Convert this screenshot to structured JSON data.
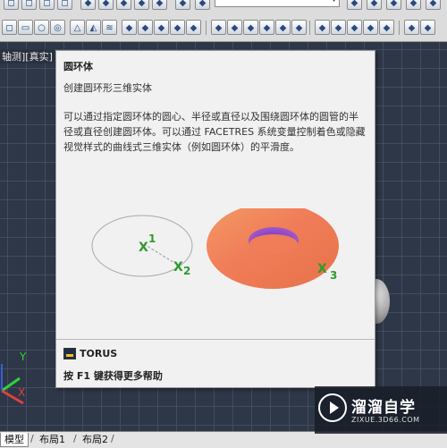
{
  "viewport": {
    "label": "轴测][真实]"
  },
  "tooltip": {
    "title": "圆环体",
    "subtitle": "创建圆环形三维实体",
    "description": "可以通过指定圆环体的圆心、半径或直径以及围绕圆环体的圆管的半径或直径创建圆环体。可以通过 FACETRES 系统变量控制着色或隐藏视觉样式的曲线式三维实体（例如圆环体）的平滑度。",
    "illustration": {
      "point_1_mark": "X",
      "point_1_label": "1",
      "point_2_mark": "X",
      "point_2_label": "2",
      "point_3_mark": "X",
      "point_3_label": "3"
    },
    "command": "TORUS",
    "help": "按 F1 键获得更多帮助"
  },
  "ucs": {
    "y_label": "Y",
    "x_label": "X"
  },
  "layout_tabs": [
    {
      "label": "模型",
      "active": true
    },
    {
      "label": "布局1",
      "active": false
    },
    {
      "label": "布局2",
      "active": false
    }
  ],
  "watermark": {
    "title": "溜溜自学",
    "url": "ZIXUE.3D66.COM"
  },
  "colors": {
    "mark_green": "#2e9a2e",
    "torus_orange": "#f3925c",
    "torus_purple": "#8f4fd8",
    "background": "#2e3747"
  }
}
